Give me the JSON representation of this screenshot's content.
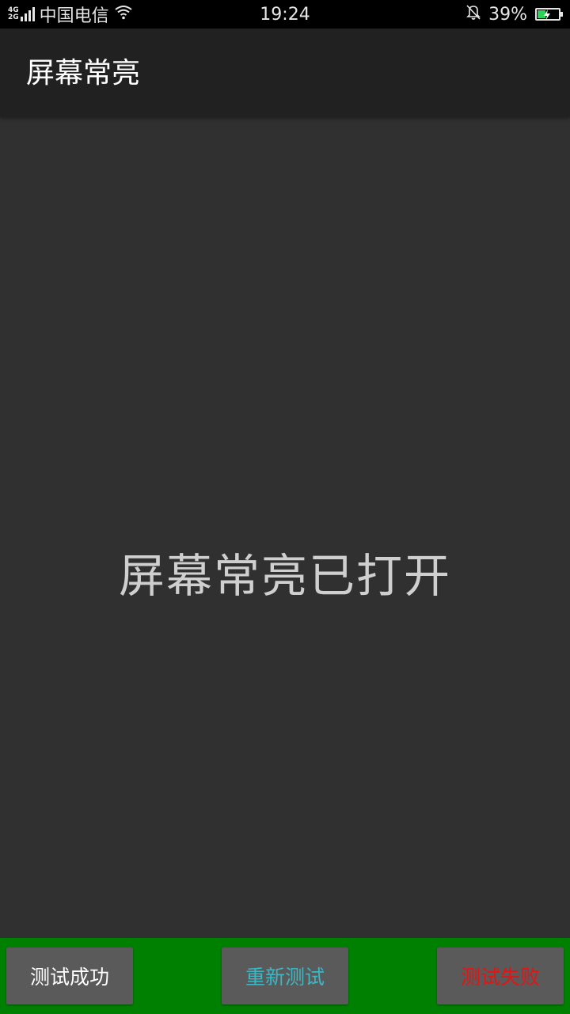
{
  "status_bar": {
    "net_type_top": "4G",
    "net_type_bottom": "2G",
    "carrier": "中国电信",
    "time": "19:24",
    "battery_percent": "39%",
    "battery_level": 0.39,
    "icons": [
      "signal-bars-icon",
      "wifi-icon",
      "bell-off-icon",
      "battery-charging-icon"
    ]
  },
  "app_bar": {
    "title": "屏幕常亮"
  },
  "content": {
    "message": "屏幕常亮已打开"
  },
  "bottom_bar": {
    "background_color": "#008000",
    "buttons": [
      {
        "label": "测试成功",
        "color": "#ffffff"
      },
      {
        "label": "重新测试",
        "color": "#3fb6c4"
      },
      {
        "label": "测试失败",
        "color": "#e31414"
      }
    ]
  }
}
